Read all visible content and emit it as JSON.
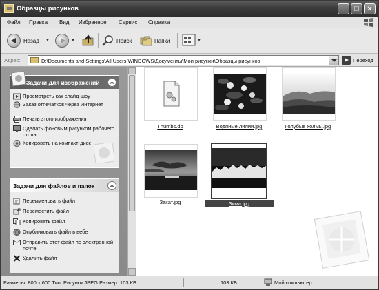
{
  "window": {
    "title": "Образцы рисунков"
  },
  "menu": [
    "Файл",
    "Правка",
    "Вид",
    "Избранное",
    "Сервис",
    "Справка"
  ],
  "toolbar": {
    "back_label": "Назад",
    "search_label": "Поиск",
    "folders_label": "Папки"
  },
  "address": {
    "label": "Адрес:",
    "path": "D:\\Documents and Settings\\All Users.WINDOWS\\Документы\\Мои рисунки\\Образцы рисунков",
    "go_label": "Переход"
  },
  "image_tasks": {
    "header": "Задачи для изображений",
    "items": [
      {
        "label": "Просмотреть как слайд-шоу",
        "icon": "slideshow-icon"
      },
      {
        "label": "Заказ отпечатков через Интернет",
        "icon": "order-prints-icon"
      },
      {
        "label": "Печать этого изображения",
        "icon": "print-icon"
      },
      {
        "label": "Сделать фоновым рисунком рабочего стола",
        "icon": "desktop-background-icon"
      },
      {
        "label": "Копировать на компакт-диск",
        "icon": "cd-icon"
      }
    ]
  },
  "file_tasks": {
    "header": "Задачи для файлов и папок",
    "items": [
      {
        "label": "Переименовать файл",
        "icon": "rename-icon"
      },
      {
        "label": "Переместить файл",
        "icon": "move-icon"
      },
      {
        "label": "Копировать файл",
        "icon": "copy-icon"
      },
      {
        "label": "Опубликовать файл в вебе",
        "icon": "web-publish-icon"
      },
      {
        "label": "Отправить этот файл по электронной почте",
        "icon": "email-icon"
      },
      {
        "label": "Удалить файл",
        "icon": "delete-icon"
      }
    ]
  },
  "files": [
    {
      "name": "Thumbs.db",
      "kind": "generic-file",
      "selected": false
    },
    {
      "name": "Водяные лилии.jpg",
      "kind": "water-lilies",
      "selected": false
    },
    {
      "name": "Голубые холмы.jpg",
      "kind": "blue-hills",
      "selected": false
    },
    {
      "name": "Закат.jpg",
      "kind": "sunset",
      "selected": false
    },
    {
      "name": "Зима.jpg",
      "kind": "winter",
      "selected": true
    }
  ],
  "status": {
    "info": "Размеры: 800 x 600 Тип: Рисунок JPEG Размер: 103 КБ",
    "size": "103 КБ",
    "location": "Мой компьютер"
  },
  "colors": {
    "titlebar": "#3c3c3c",
    "left_pane": "#8f8f8f",
    "task_panel": "#ececec",
    "selection": "#444444"
  }
}
